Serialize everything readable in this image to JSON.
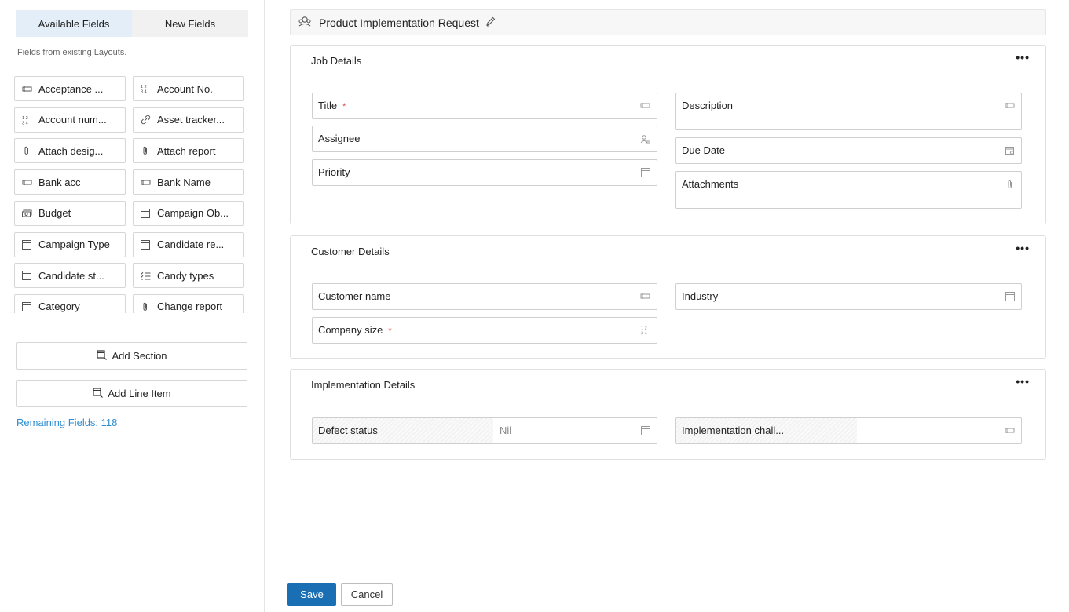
{
  "sidebar": {
    "tabs": [
      {
        "label": "Available Fields",
        "active": true
      },
      {
        "label": "New Fields",
        "active": false
      }
    ],
    "hint": "Fields from existing Layouts.",
    "fields": [
      {
        "label": "Acceptance ...",
        "icon": "single-line-icon"
      },
      {
        "label": "Account No.",
        "icon": "number-icon"
      },
      {
        "label": "Account num...",
        "icon": "number-icon"
      },
      {
        "label": "Asset tracker...",
        "icon": "link-icon"
      },
      {
        "label": "Attach desig...",
        "icon": "attachment-icon"
      },
      {
        "label": "Attach report",
        "icon": "attachment-icon"
      },
      {
        "label": "Bank acc",
        "icon": "single-line-icon"
      },
      {
        "label": "Bank Name",
        "icon": "single-line-icon"
      },
      {
        "label": "Budget",
        "icon": "currency-icon"
      },
      {
        "label": "Campaign Ob...",
        "icon": "picklist-icon"
      },
      {
        "label": "Campaign Type",
        "icon": "picklist-icon"
      },
      {
        "label": "Candidate re...",
        "icon": "picklist-icon"
      },
      {
        "label": "Candidate st...",
        "icon": "picklist-icon"
      },
      {
        "label": "Candy types",
        "icon": "multiselect-icon"
      },
      {
        "label": "Category",
        "icon": "picklist-icon"
      },
      {
        "label": "Change report",
        "icon": "attachment-icon"
      }
    ],
    "add_section": "Add Section",
    "add_line_item": "Add Line Item",
    "remaining": "Remaining Fields: 118"
  },
  "layout": {
    "title": "Product Implementation Request",
    "sections": [
      {
        "title": "Job Details",
        "left": [
          {
            "label": "Title",
            "required": true,
            "icon": "single-line-icon"
          },
          {
            "label": "Assignee",
            "required": false,
            "icon": "user-icon"
          },
          {
            "label": "Priority",
            "required": false,
            "icon": "picklist-icon"
          }
        ],
        "right": [
          {
            "label": "Description",
            "icon": "single-line-icon"
          },
          {
            "label": "Due Date",
            "icon": "calendar-icon"
          },
          {
            "label": "Attachments",
            "icon": "attachment-icon"
          }
        ]
      },
      {
        "title": "Customer Details",
        "left": [
          {
            "label": "Customer name",
            "required": false,
            "icon": "single-line-icon"
          },
          {
            "label": "Company size",
            "required": true,
            "icon": "number-icon"
          }
        ],
        "right": [
          {
            "label": "Industry",
            "icon": "picklist-icon"
          }
        ]
      },
      {
        "title": "Implementation Details",
        "left": [
          {
            "label": "Defect status",
            "value": "Nil",
            "icon": "picklist-icon"
          }
        ],
        "right": [
          {
            "label": "Implementation chall...",
            "icon": "single-line-icon"
          }
        ]
      }
    ]
  },
  "actions": {
    "save": "Save",
    "cancel": "Cancel"
  },
  "more_menu": "•••",
  "required_mark": "*",
  "colors": {
    "primary": "#1a6eb4",
    "link": "#2f8fd0",
    "required": "#e05050",
    "active_tab": "#e3eef9"
  }
}
